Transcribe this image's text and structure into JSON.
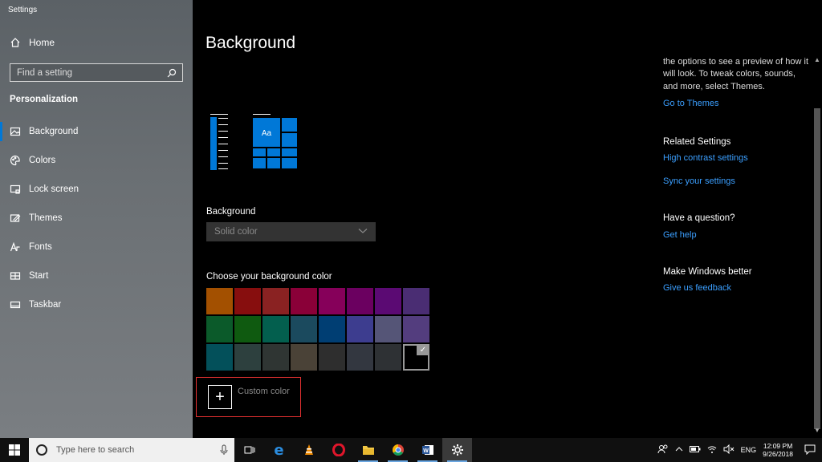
{
  "window": {
    "title": "Settings"
  },
  "sidebar": {
    "home_label": "Home",
    "search_placeholder": "Find a setting",
    "section_title": "Personalization",
    "items": [
      {
        "label": "Background",
        "icon": "picture-icon",
        "active": true
      },
      {
        "label": "Colors",
        "icon": "palette-icon",
        "active": false
      },
      {
        "label": "Lock screen",
        "icon": "lock-screen-icon",
        "active": false
      },
      {
        "label": "Themes",
        "icon": "themes-icon",
        "active": false
      },
      {
        "label": "Fonts",
        "icon": "fonts-icon",
        "active": false
      },
      {
        "label": "Start",
        "icon": "start-icon",
        "active": false
      },
      {
        "label": "Taskbar",
        "icon": "taskbar-icon",
        "active": false
      }
    ]
  },
  "main": {
    "title": "Background",
    "preview_text": "Aa",
    "background_label": "Background",
    "background_value": "Solid color",
    "choose_label": "Choose your background color",
    "swatches": [
      "#a35000",
      "#870e0e",
      "#8a2222",
      "#8a0038",
      "#86005a",
      "#6b0060",
      "#5b0a73",
      "#4a2d73",
      "#0b5a2a",
      "#0f5a10",
      "#035f4e",
      "#1b4a5e",
      "#003e73",
      "#3d3d8f",
      "#555577",
      "#533d7e",
      "#03505a",
      "#2d403e",
      "#2f3533",
      "#4a4237",
      "#2e2e2e",
      "#333740",
      "#2e3134",
      "#000000"
    ],
    "selected_swatch": 23,
    "custom_color_label": "Custom color"
  },
  "right": {
    "intro_text": "the options to see a preview of how it will look. To tweak colors, sounds, and more, select Themes.",
    "go_to_themes": "Go to Themes",
    "related_title": "Related Settings",
    "high_contrast": "High contrast settings",
    "sync_settings": "Sync your settings",
    "question_title": "Have a question?",
    "get_help": "Get help",
    "better_title": "Make Windows better",
    "feedback": "Give us feedback"
  },
  "taskbar": {
    "search_placeholder": "Type here to search",
    "apps": [
      "task-view-icon",
      "edge-icon",
      "vlc-icon",
      "opera-icon",
      "file-explorer-icon",
      "chrome-icon",
      "word-icon",
      "settings-icon"
    ],
    "language": "ENG",
    "time": "12:09 PM",
    "date": "9/26/2018"
  },
  "colors": {
    "accent": "#0078d7",
    "link": "#3b9fff",
    "highlight_box": "#e23030"
  }
}
